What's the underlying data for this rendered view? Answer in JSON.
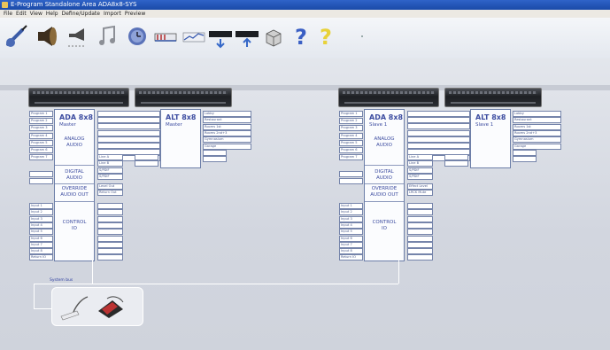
{
  "window": {
    "title": "E-Program Standalone Area ADA8x8-SYS"
  },
  "menu": [
    "File",
    "Edit",
    "View",
    "Help",
    "Define/Update",
    "Import",
    "Preview"
  ],
  "toolbar": [
    {
      "name": "guitar-icon"
    },
    {
      "name": "speaker-icon"
    },
    {
      "name": "horn-icon"
    },
    {
      "name": "music-note-icon"
    },
    {
      "name": "clock-icon"
    },
    {
      "name": "book-icon"
    },
    {
      "name": "graph-icon"
    },
    {
      "name": "download-device-icon"
    },
    {
      "name": "upload-device-icon"
    },
    {
      "name": "package-icon"
    },
    {
      "name": "help-icon"
    },
    {
      "name": "context-help-icon"
    }
  ],
  "left_group": {
    "ada": {
      "title": "ADA 8x8",
      "role": "Master",
      "analog": "ANALOG\nAUDIO",
      "digital": "DIGITAL\nAUDIO",
      "override": "OVERRIDE\nAUDIO OUT",
      "control": "CONTROL\nIO"
    },
    "alt": {
      "title": "ALT 8x8",
      "role": "Master"
    },
    "inputs": [
      "Program 1",
      "Program 2",
      "Program 3",
      "Program 4",
      "Program 5",
      "Program 6",
      "Program 7"
    ],
    "digital_inputs": [
      "",
      ""
    ],
    "control_inputs": [
      "Input 1",
      "Input 2",
      "Input 3",
      "Input 4",
      "Input 5",
      "Input 6",
      "Input 7",
      "Input 8",
      "Return IO"
    ],
    "outputs": [
      "",
      "",
      "",
      "",
      "",
      "",
      "",
      "",
      "Line A",
      "Line B",
      "S/PDIF",
      "S/PDIF",
      "Level Out",
      "Return Out",
      "",
      "",
      "",
      "",
      "",
      "",
      "",
      "",
      ""
    ],
    "alt_outputs": [
      "Lobby",
      "Restaurant",
      "Rooms 1st",
      "Rooms 2nd+3",
      "Gymnasium",
      "Garage",
      "",
      ""
    ],
    "bus_label": "System bus"
  },
  "right_group": {
    "ada": {
      "title": "ADA 8x8",
      "role": "Slave 1",
      "analog": "ANALOG\nAUDIO",
      "digital": "DIGITAL\nAUDIO",
      "override": "OVERRIDE\nAUDIO OUT",
      "control": "CONTROL\nIO"
    },
    "alt": {
      "title": "ALT 8x8",
      "role": "Slave 1"
    },
    "inputs": [
      "Program 1",
      "Program 2",
      "Program 3",
      "Program 4",
      "Program 5",
      "Program 6",
      "Program 7"
    ],
    "digital_inputs": [
      "",
      ""
    ],
    "control_inputs": [
      "Input 1",
      "Input 2",
      "Input 3",
      "Input 4",
      "Input 5",
      "Input 6",
      "Input 7",
      "Input 8",
      "Return IO"
    ],
    "outputs": [
      "",
      "",
      "",
      "",
      "",
      "",
      "",
      "",
      "Line A",
      "Line B",
      "S/PDIF",
      "S/PDIF",
      "Effect Level",
      "LRCK Mute",
      "",
      "",
      "",
      "",
      "",
      "",
      "",
      "",
      ""
    ],
    "alt_outputs": [
      "Lobby",
      "Restaurant",
      "Rooms 1st",
      "Rooms 2nd+3",
      "Gymnasium",
      "Garage",
      "",
      ""
    ]
  }
}
